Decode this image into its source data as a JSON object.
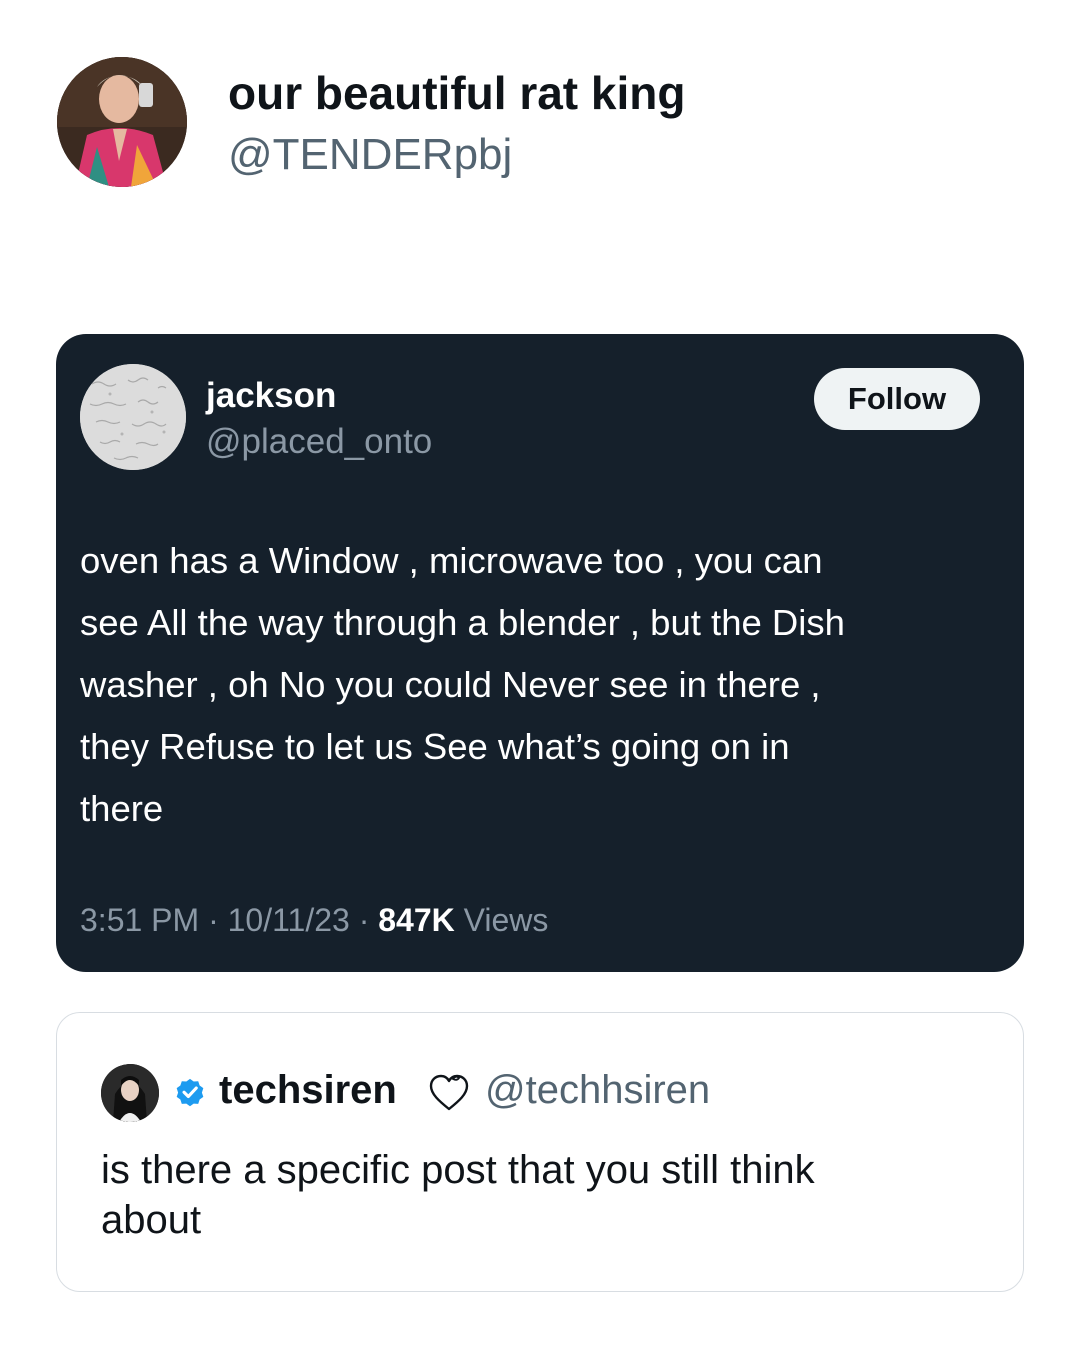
{
  "header": {
    "display_name": "our beautiful rat king",
    "handle": "@TENDERpbj"
  },
  "embedded_tweet": {
    "display_name": "jackson",
    "handle": "@placed_onto",
    "follow_label": "Follow",
    "body_lines": [
      "oven has a Window , microwave too , you can",
      "see All the way through a blender , but the Dish",
      "washer , oh No you could Never see in there ,",
      "they Refuse to let us See what’s going on in",
      "there"
    ],
    "time": "3:51 PM",
    "separator": "·",
    "date": "10/11/23",
    "views_count": "847K",
    "views_label": "Views"
  },
  "quote": {
    "display_name": "techsiren",
    "handle": "@techhsiren",
    "body_lines": [
      "is there a specific post that you still think",
      "about"
    ],
    "verified_color": "#1d9bf0"
  },
  "colors": {
    "dark_card_bg": "#15202b",
    "muted_gray": "#8b98a5",
    "handle_gray": "#536471",
    "follow_bg": "#eff3f4"
  }
}
